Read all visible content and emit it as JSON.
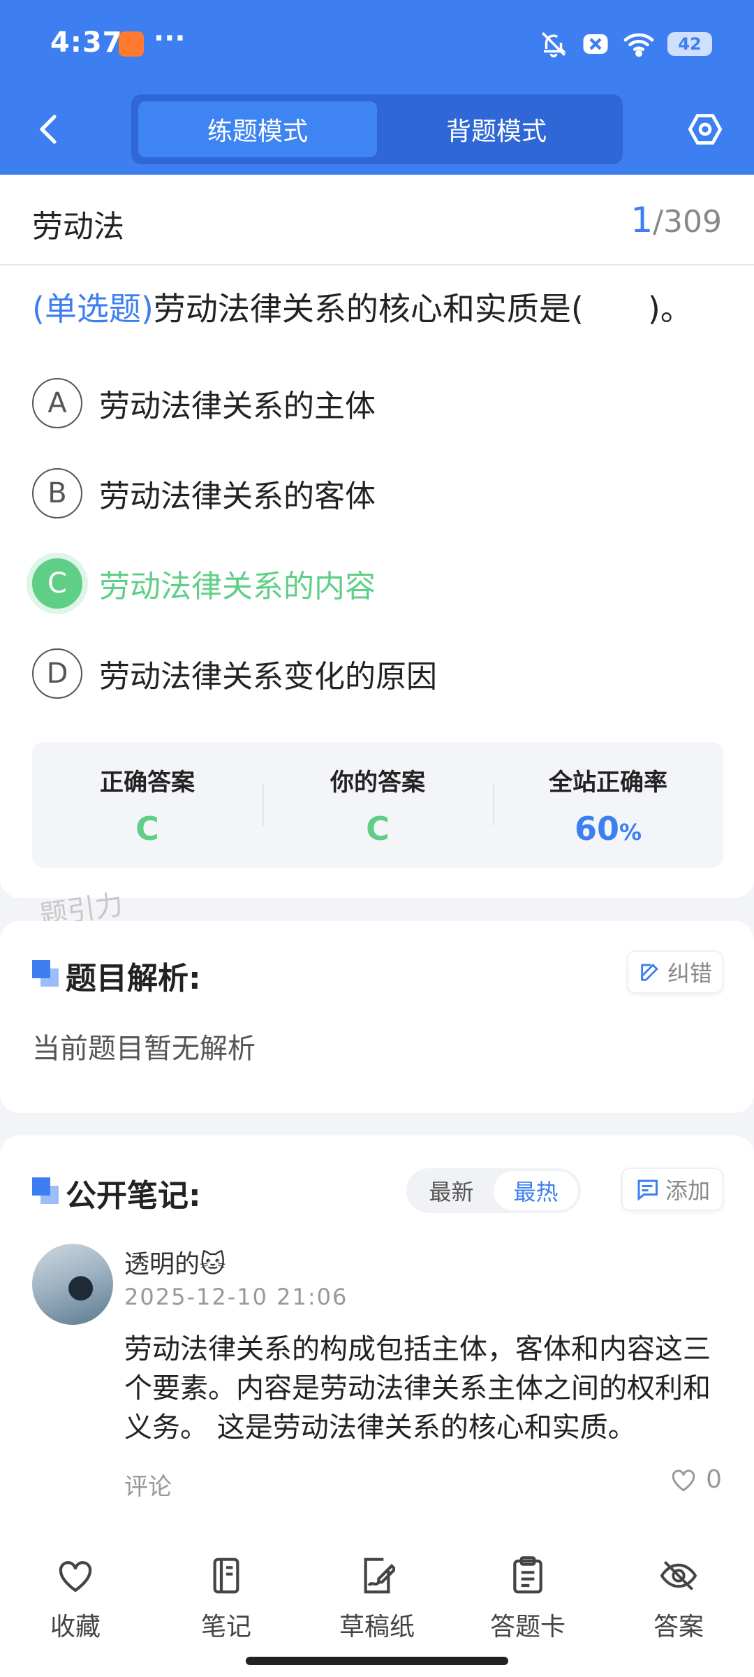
{
  "status_bar": {
    "time": "4:37",
    "more": "···",
    "battery": "42"
  },
  "nav": {
    "tabs": [
      {
        "label": "练题模式",
        "active": true
      },
      {
        "label": "背题模式",
        "active": false
      }
    ]
  },
  "question": {
    "section": "劳动法",
    "current": "1",
    "total": "/309",
    "type": "(单选题)",
    "text": "劳动法律关系的核心和实质是(　　)。",
    "options": [
      {
        "letter": "A",
        "text": "劳动法律关系的主体"
      },
      {
        "letter": "B",
        "text": "劳动法律关系的客体"
      },
      {
        "letter": "C",
        "text": "劳动法律关系的内容"
      },
      {
        "letter": "D",
        "text": "劳动法律关系变化的原因"
      }
    ],
    "selected": "C"
  },
  "stats": {
    "correct_label": "正确答案",
    "correct_value": "C",
    "yours_label": "你的答案",
    "yours_value": "C",
    "rate_label": "全站正确率",
    "rate_value": "60",
    "rate_unit": "%"
  },
  "watermark": "题引力",
  "analysis": {
    "title": "题目解析:",
    "report_label": "纠错",
    "body": "当前题目暂无解析"
  },
  "notes": {
    "title": "公开笔记:",
    "sort": [
      "最新",
      "最热"
    ],
    "sort_active": "最热",
    "add_label": "添加",
    "item": {
      "user": "透明的🐱",
      "time": "2025-12-10 21:06",
      "text": "劳动法律关系的构成包括主体，客体和内容这三个要素。内容是劳动法律关系主体之间的权利和义务。 这是劳动法律关系的核心和实质。",
      "comment_label": "评论",
      "likes": "0"
    }
  },
  "tabbar": [
    {
      "label": "收藏",
      "icon": "heart-icon"
    },
    {
      "label": "笔记",
      "icon": "notebook-icon"
    },
    {
      "label": "草稿纸",
      "icon": "draft-paper-icon"
    },
    {
      "label": "答题卡",
      "icon": "answer-sheet-icon"
    },
    {
      "label": "答案",
      "icon": "eye-off-icon"
    }
  ],
  "colors": {
    "primary": "#3d7ff0",
    "correct": "#5fcf86"
  }
}
